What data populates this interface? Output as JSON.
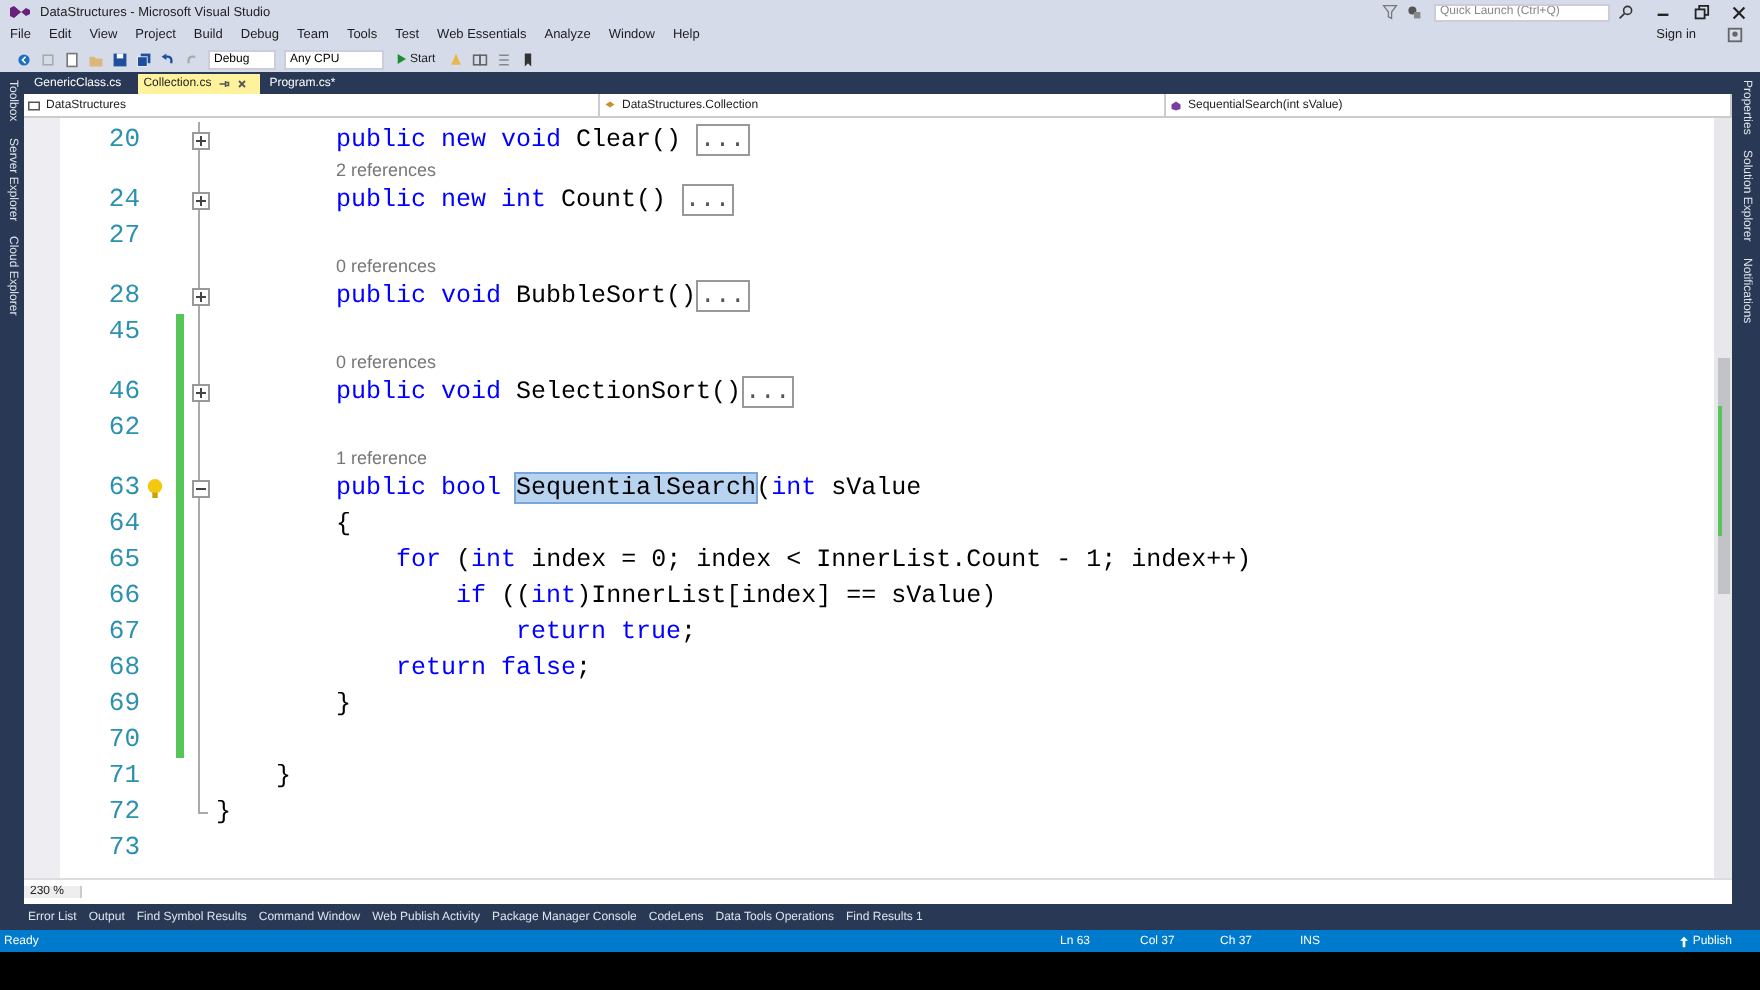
{
  "window": {
    "title": "DataStructures - Microsoft Visual Studio",
    "quick_launch": {
      "placeholder": "Quick Launch (Ctrl+Q)"
    },
    "sign_in": "Sign in"
  },
  "menu": [
    "File",
    "Edit",
    "View",
    "Project",
    "Build",
    "Debug",
    "Team",
    "Tools",
    "Test",
    "Web Essentials",
    "Analyze",
    "Window",
    "Help"
  ],
  "toolbar": {
    "configuration": "Debug",
    "platform": "Any CPU",
    "start": "Start"
  },
  "left_strip": [
    "Toolbox",
    "Server Explorer",
    "Cloud Explorer"
  ],
  "right_strip": [
    "Properties",
    "Solution Explorer",
    "Notifications"
  ],
  "tabs": [
    {
      "label": "GenericClass.cs",
      "selected": false
    },
    {
      "label": "Collection.cs",
      "selected": true
    },
    {
      "label": "Program.cs*",
      "selected": false
    }
  ],
  "navigation": {
    "project": "DataStructures",
    "type": "DataStructures.Collection",
    "member": "SequentialSearch(int sValue)"
  },
  "lines": [
    {
      "kind": "code",
      "number": "20",
      "collapsed": true,
      "changed": false,
      "lightbulb": false,
      "segments": [
        {
          "text": "        public new void",
          "kind": "kw"
        },
        {
          "text": " Clear() ",
          "kind": "plain"
        },
        {
          "text": "...",
          "kind": "fold"
        }
      ]
    },
    {
      "kind": "codelens",
      "text": "2 references",
      "changed": false
    },
    {
      "kind": "code",
      "number": "24",
      "collapsed": true,
      "changed": false,
      "lightbulb": false,
      "segments": [
        {
          "text": "        public new int",
          "kind": "kw"
        },
        {
          "text": " Count() ",
          "kind": "plain"
        },
        {
          "text": "...",
          "kind": "fold"
        }
      ]
    },
    {
      "kind": "code",
      "number": "27",
      "changed": false,
      "lightbulb": false
    },
    {
      "kind": "codelens",
      "text": "0 references",
      "changed": false
    },
    {
      "kind": "code",
      "number": "28",
      "collapsed": true,
      "changed": false,
      "lightbulb": false,
      "segments": [
        {
          "text": "        public void",
          "kind": "kw"
        },
        {
          "text": " BubbleSort()",
          "kind": "plain"
        },
        {
          "text": "...",
          "kind": "fold"
        }
      ]
    },
    {
      "kind": "code",
      "number": "45",
      "changed": true,
      "lightbulb": false
    },
    {
      "kind": "codelens",
      "text": "0 references",
      "changed": true
    },
    {
      "kind": "code",
      "number": "46",
      "collapsed": true,
      "changed": true,
      "lightbulb": false,
      "segments": [
        {
          "text": "        public void",
          "kind": "kw"
        },
        {
          "text": " SelectionSort()",
          "kind": "plain"
        },
        {
          "text": "...",
          "kind": "fold"
        }
      ]
    },
    {
      "kind": "code",
      "number": "62",
      "changed": true,
      "lightbulb": false
    },
    {
      "kind": "codelens",
      "text": "1 reference",
      "changed": true
    },
    {
      "kind": "code",
      "number": "63",
      "collapsed": false,
      "changed": true,
      "lightbulb": true,
      "segments": [
        {
          "text": "        public bool ",
          "kind": "kw"
        },
        {
          "text": "SequentialSearch",
          "kind": "match"
        },
        {
          "text": "(",
          "kind": "plain"
        },
        {
          "text": "int",
          "kind": "kw"
        },
        {
          "text": " sValue",
          "kind": "plain"
        }
      ]
    },
    {
      "kind": "code",
      "number": "64",
      "changed": true,
      "lightbulb": false,
      "segments": [
        {
          "text": "        {",
          "kind": "plain"
        }
      ]
    },
    {
      "kind": "code",
      "number": "65",
      "changed": true,
      "lightbulb": false,
      "segments": [
        {
          "text": "            for",
          "kind": "kw"
        },
        {
          "text": " (",
          "kind": "plain"
        },
        {
          "text": "int",
          "kind": "kw"
        },
        {
          "text": " index = 0; index < InnerList.Count - 1; index++)",
          "kind": "plain"
        }
      ]
    },
    {
      "kind": "code",
      "number": "66",
      "changed": true,
      "lightbulb": false,
      "segments": [
        {
          "text": "                if",
          "kind": "kw"
        },
        {
          "text": " ((",
          "kind": "plain"
        },
        {
          "text": "int",
          "kind": "kw"
        },
        {
          "text": ")InnerList[index] == sValue)",
          "kind": "plain"
        }
      ]
    },
    {
      "kind": "code",
      "number": "67",
      "changed": true,
      "lightbulb": false,
      "segments": [
        {
          "text": "                    return true",
          "kind": "kw"
        },
        {
          "text": ";",
          "kind": "plain"
        }
      ]
    },
    {
      "kind": "code",
      "number": "68",
      "changed": true,
      "lightbulb": false,
      "segments": [
        {
          "text": "            return false",
          "kind": "kw"
        },
        {
          "text": ";",
          "kind": "plain"
        }
      ]
    },
    {
      "kind": "code",
      "number": "69",
      "changed": true,
      "lightbulb": false,
      "segments": [
        {
          "text": "        }",
          "kind": "plain"
        }
      ]
    },
    {
      "kind": "code",
      "number": "70",
      "changed": true,
      "lightbulb": false
    },
    {
      "kind": "code",
      "number": "71",
      "changed": false,
      "lightbulb": false,
      "segments": [
        {
          "text": "    }",
          "kind": "plain"
        }
      ]
    },
    {
      "kind": "code",
      "number": "72",
      "changed": false,
      "lightbulb": false,
      "segments": [
        {
          "text": "}",
          "kind": "plain"
        }
      ]
    },
    {
      "kind": "code",
      "number": "73",
      "changed": false,
      "lightbulb": false
    }
  ],
  "zoom": "230 %",
  "bottom_tabs": [
    "Error List",
    "Output",
    "Find Symbol Results",
    "Command Window",
    "Web Publish Activity",
    "Package Manager Console",
    "CodeLens",
    "Data Tools Operations",
    "Find Results 1"
  ],
  "status_bar": {
    "state": "Ready",
    "line": "Ln 63",
    "column": "Col 37",
    "char": "Ch 37",
    "mode": "INS",
    "publish": "Publish"
  }
}
